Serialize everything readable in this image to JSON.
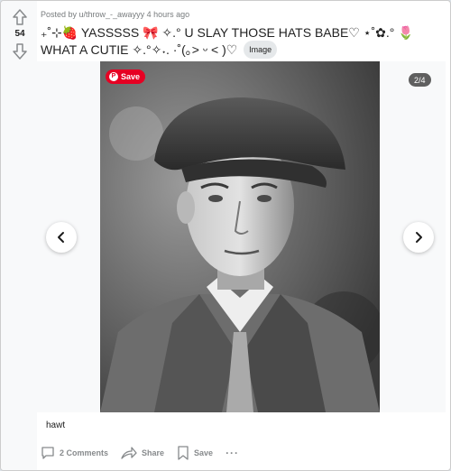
{
  "post": {
    "score": "54",
    "meta_prefix": "Posted by ",
    "author": "u/throw_-_awayyy",
    "time": "4 hours ago",
    "title": "₊˚⊹🍓 YASSSSS 🎀 ✧.° U SLAY THOSE HATS BABE♡ ⋆˚✿.° 🌷 WHAT A CUTIE ✧.°✧˖. ·˚(｡> ᵕ < )♡",
    "flair": "Image",
    "caption": "hawt"
  },
  "gallery": {
    "save_label": "Save",
    "counter": "2/4"
  },
  "actions": {
    "comments": "2 Comments",
    "share": "Share",
    "save": "Save",
    "more": "···"
  },
  "colors": {
    "page_bg": "#dae0e6",
    "card_bg": "#ffffff",
    "vote_col_bg": "#f8f9fa",
    "pinterest_red": "#e60023",
    "muted_text": "#878a8c"
  },
  "icons": [
    "upvote-arrow-icon",
    "downvote-arrow-icon",
    "pinterest-icon",
    "chevron-left-icon",
    "chevron-right-icon",
    "comment-icon",
    "share-icon",
    "bookmark-icon"
  ]
}
